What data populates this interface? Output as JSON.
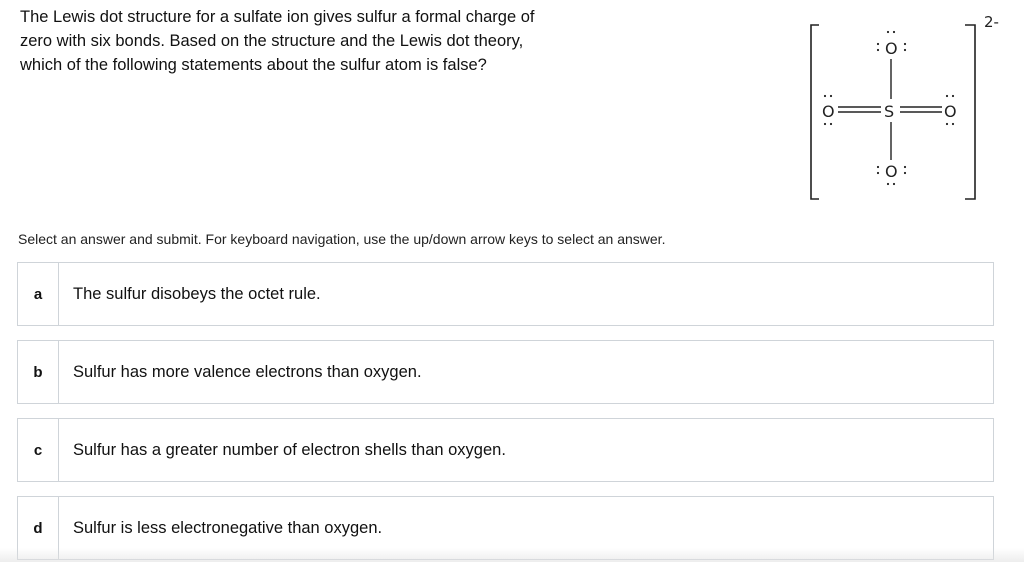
{
  "question": {
    "line1": "The Lewis dot structure for a sulfate ion gives sulfur a formal charge of",
    "line2": "zero with six bonds. Based on the structure and the Lewis dot theory,",
    "line3": "which of the following statements about the sulfur atom is false?"
  },
  "structure": {
    "charge": "2-",
    "top_oxygen": "O",
    "left_oxygen": "O",
    "right_oxygen": "O",
    "bottom_oxygen": "O",
    "sulfur": "S"
  },
  "instructions": "Select an answer and submit. For keyboard navigation, use the up/down arrow keys to select an answer.",
  "options": [
    {
      "letter": "a",
      "text": "The sulfur disobeys the octet rule."
    },
    {
      "letter": "b",
      "text": "Sulfur has more valence electrons than oxygen."
    },
    {
      "letter": "c",
      "text": "Sulfur has a greater number of electron shells than oxygen."
    },
    {
      "letter": "d",
      "text": "Sulfur is less electronegative than oxygen."
    }
  ]
}
